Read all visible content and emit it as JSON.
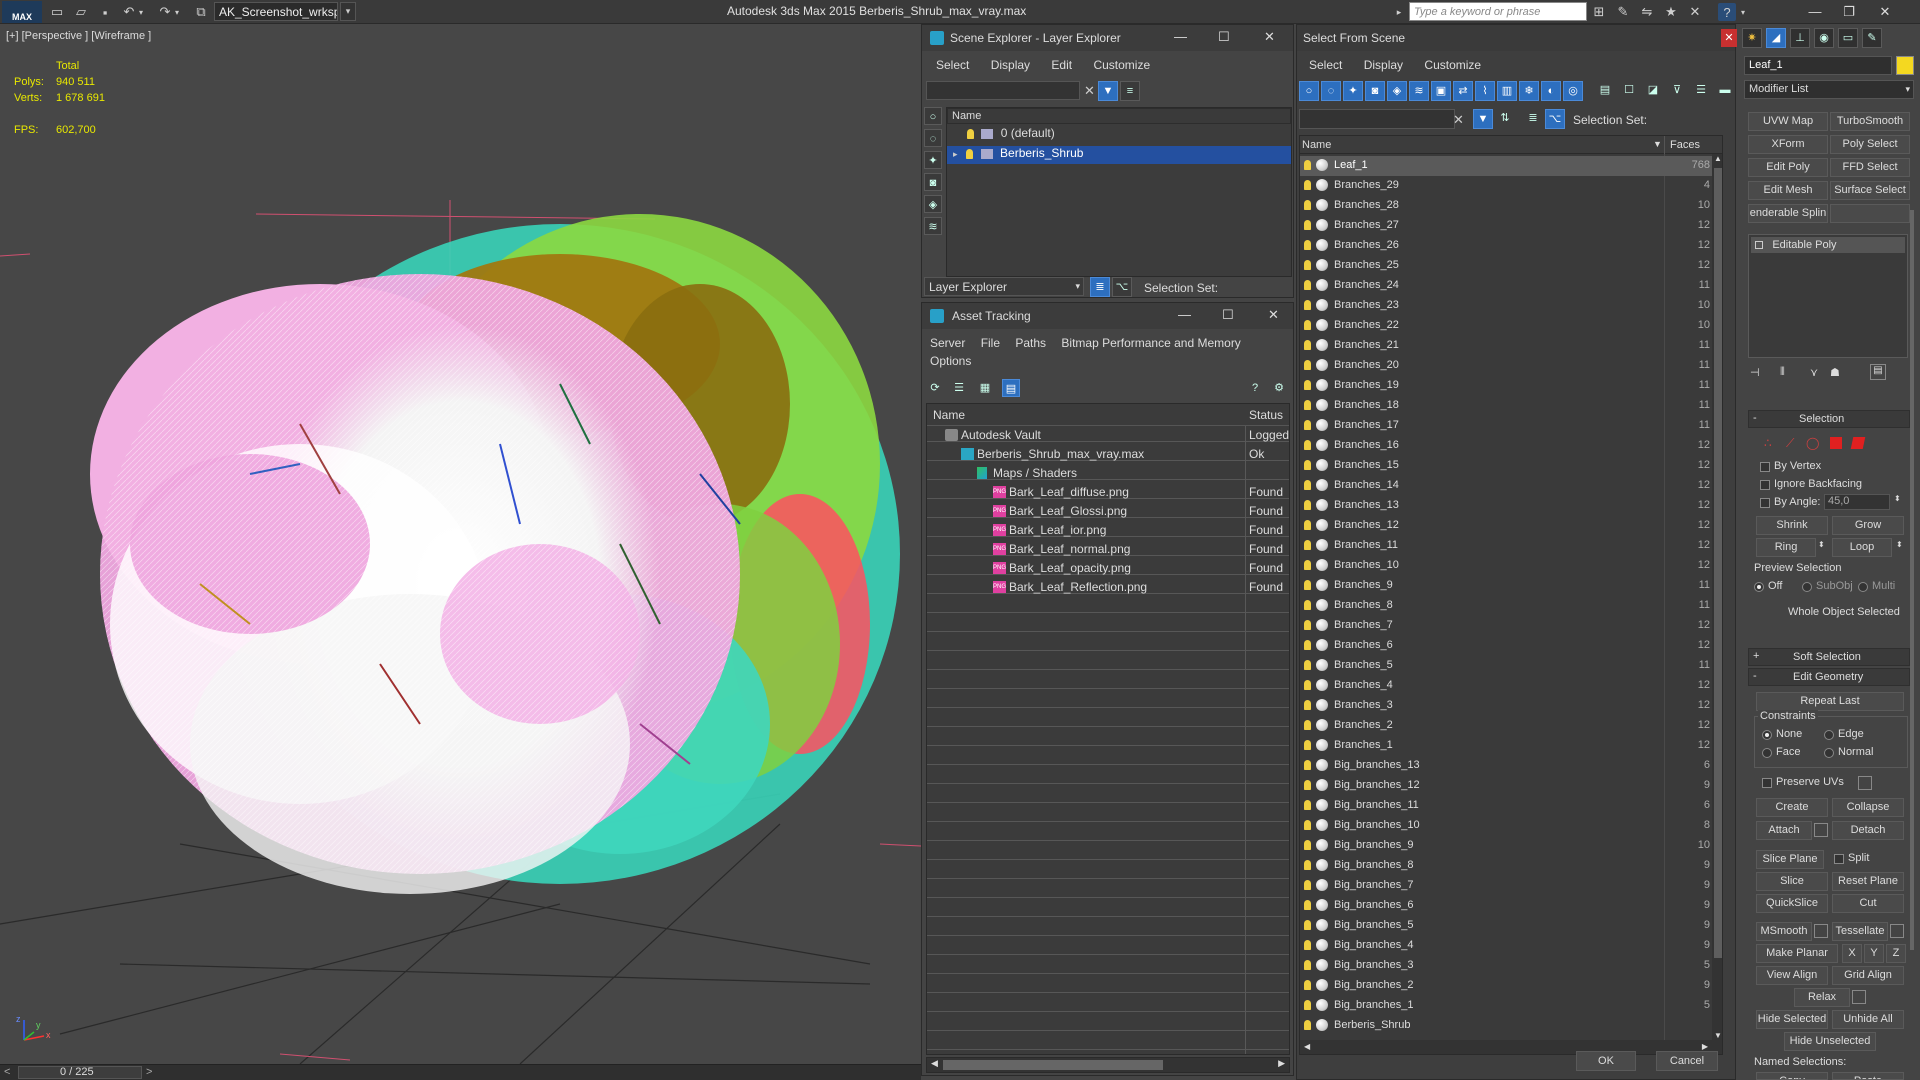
{
  "app": {
    "logo_text": "MAX",
    "title": "Autodesk 3ds Max  2015    Berberis_Shrub_max_vray.max",
    "workspace": "AK_Screenshot_wrksp",
    "search_placeholder": "Type a keyword or phrase"
  },
  "viewport": {
    "label": "[+] [Perspective ] [Wireframe ]",
    "stats": {
      "total_label": "Total",
      "polys_label": "Polys:",
      "polys_value": "940 511",
      "verts_label": "Verts:",
      "verts_value": "1 678 691",
      "fps_label": "FPS:",
      "fps_value": "602,700"
    },
    "axis": {
      "x": "x",
      "y": "y",
      "z": "z"
    },
    "timeline": "0 / 225"
  },
  "scene_explorer": {
    "title": "Scene Explorer - Layer Explorer",
    "menu": [
      "Select",
      "Display",
      "Edit",
      "Customize"
    ],
    "col_name": "Name",
    "layers": [
      {
        "name": "0 (default)",
        "selected": false
      },
      {
        "name": "Berberis_Shrub",
        "selected": true
      }
    ],
    "footer_dropdown": "Layer Explorer",
    "footer_selection": "Selection Set:"
  },
  "asset_tracking": {
    "title": "Asset Tracking",
    "menu": [
      "Server",
      "File",
      "Paths",
      "Bitmap Performance and Memory",
      "Options"
    ],
    "col_name": "Name",
    "col_status": "Status",
    "rows": [
      {
        "name": "Autodesk Vault",
        "status": "Logged",
        "indent": 0,
        "icon": "vault"
      },
      {
        "name": "Berberis_Shrub_max_vray.max",
        "status": "Ok",
        "indent": 1,
        "icon": "max"
      },
      {
        "name": "Maps / Shaders",
        "status": "",
        "indent": 2,
        "icon": "maps"
      },
      {
        "name": "Bark_Leaf_diffuse.png",
        "status": "Found",
        "indent": 3,
        "icon": "png"
      },
      {
        "name": "Bark_Leaf_Glossi.png",
        "status": "Found",
        "indent": 3,
        "icon": "png"
      },
      {
        "name": "Bark_Leaf_ior.png",
        "status": "Found",
        "indent": 3,
        "icon": "png"
      },
      {
        "name": "Bark_Leaf_normal.png",
        "status": "Found",
        "indent": 3,
        "icon": "png"
      },
      {
        "name": "Bark_Leaf_opacity.png",
        "status": "Found",
        "indent": 3,
        "icon": "png"
      },
      {
        "name": "Bark_Leaf_Reflection.png",
        "status": "Found",
        "indent": 3,
        "icon": "png"
      }
    ],
    "png_badge": "PNG"
  },
  "select_from_scene": {
    "title": "Select From Scene",
    "menu": [
      "Select",
      "Display",
      "Customize"
    ],
    "selection_set": "Selection Set:",
    "col_name": "Name",
    "col_faces": "Faces",
    "objects": [
      {
        "name": "Leaf_1",
        "faces": "768",
        "selected": true
      },
      {
        "name": "Branches_29",
        "faces": "4"
      },
      {
        "name": "Branches_28",
        "faces": "10"
      },
      {
        "name": "Branches_27",
        "faces": "12"
      },
      {
        "name": "Branches_26",
        "faces": "12"
      },
      {
        "name": "Branches_25",
        "faces": "12"
      },
      {
        "name": "Branches_24",
        "faces": "11"
      },
      {
        "name": "Branches_23",
        "faces": "10"
      },
      {
        "name": "Branches_22",
        "faces": "10"
      },
      {
        "name": "Branches_21",
        "faces": "11"
      },
      {
        "name": "Branches_20",
        "faces": "11"
      },
      {
        "name": "Branches_19",
        "faces": "11"
      },
      {
        "name": "Branches_18",
        "faces": "11"
      },
      {
        "name": "Branches_17",
        "faces": "11"
      },
      {
        "name": "Branches_16",
        "faces": "12"
      },
      {
        "name": "Branches_15",
        "faces": "12"
      },
      {
        "name": "Branches_14",
        "faces": "12"
      },
      {
        "name": "Branches_13",
        "faces": "12"
      },
      {
        "name": "Branches_12",
        "faces": "12"
      },
      {
        "name": "Branches_11",
        "faces": "12"
      },
      {
        "name": "Branches_10",
        "faces": "12"
      },
      {
        "name": "Branches_9",
        "faces": "11"
      },
      {
        "name": "Branches_8",
        "faces": "11"
      },
      {
        "name": "Branches_7",
        "faces": "12"
      },
      {
        "name": "Branches_6",
        "faces": "12"
      },
      {
        "name": "Branches_5",
        "faces": "11"
      },
      {
        "name": "Branches_4",
        "faces": "12"
      },
      {
        "name": "Branches_3",
        "faces": "12"
      },
      {
        "name": "Branches_2",
        "faces": "12"
      },
      {
        "name": "Branches_1",
        "faces": "12"
      },
      {
        "name": "Big_branches_13",
        "faces": "6"
      },
      {
        "name": "Big_branches_12",
        "faces": "9"
      },
      {
        "name": "Big_branches_11",
        "faces": "6"
      },
      {
        "name": "Big_branches_10",
        "faces": "8"
      },
      {
        "name": "Big_branches_9",
        "faces": "10"
      },
      {
        "name": "Big_branches_8",
        "faces": "9"
      },
      {
        "name": "Big_branches_7",
        "faces": "9"
      },
      {
        "name": "Big_branches_6",
        "faces": "9"
      },
      {
        "name": "Big_branches_5",
        "faces": "9"
      },
      {
        "name": "Big_branches_4",
        "faces": "9"
      },
      {
        "name": "Big_branches_3",
        "faces": "5"
      },
      {
        "name": "Big_branches_2",
        "faces": "9"
      },
      {
        "name": "Big_branches_1",
        "faces": "5"
      },
      {
        "name": "Berberis_Shrub",
        "faces": ""
      }
    ],
    "ok": "OK",
    "cancel": "Cancel"
  },
  "command_panel": {
    "object_name": "Leaf_1",
    "modifier_list": "Modifier List",
    "modifier_buttons": [
      "UVW Map",
      "TurboSmooth",
      "XForm",
      "Poly Select",
      "Edit Poly",
      "FFD Select",
      "Edit Mesh",
      "Surface Select",
      "enderable Splin",
      ""
    ],
    "stack_item": "Editable Poly",
    "selection": {
      "title": "Selection",
      "by_vertex": "By Vertex",
      "ignore_backfacing": "Ignore Backfacing",
      "by_angle": "By Angle:",
      "angle_value": "45,0",
      "shrink": "Shrink",
      "grow": "Grow",
      "ring": "Ring",
      "loop": "Loop",
      "preview_selection": "Preview Selection",
      "off": "Off",
      "subobj": "SubObj",
      "multi": "Multi",
      "status": "Whole Object Selected"
    },
    "soft_selection": "Soft Selection",
    "edit_geometry": {
      "title": "Edit Geometry",
      "repeat_last": "Repeat Last",
      "constraints": "Constraints",
      "none": "None",
      "edge": "Edge",
      "face": "Face",
      "normal": "Normal",
      "preserve_uvs": "Preserve UVs",
      "create": "Create",
      "collapse": "Collapse",
      "attach": "Attach",
      "detach": "Detach",
      "slice_plane": "Slice Plane",
      "split": "Split",
      "slice": "Slice",
      "reset_plane": "Reset Plane",
      "quickslice": "QuickSlice",
      "cut": "Cut",
      "msmooth": "MSmooth",
      "tessellate": "Tessellate",
      "make_planar": "Make Planar",
      "x": "X",
      "y": "Y",
      "z": "Z",
      "view_align": "View Align",
      "grid_align": "Grid Align",
      "relax": "Relax",
      "hide_selected": "Hide Selected",
      "unhide_all": "Unhide All",
      "hide_unselected": "Hide Unselected",
      "named_selections": "Named Selections:",
      "copy": "Copy",
      "paste": "Paste"
    },
    "colors": {
      "accent": "#2d6fbf",
      "selected_row": "#2450a0"
    }
  }
}
